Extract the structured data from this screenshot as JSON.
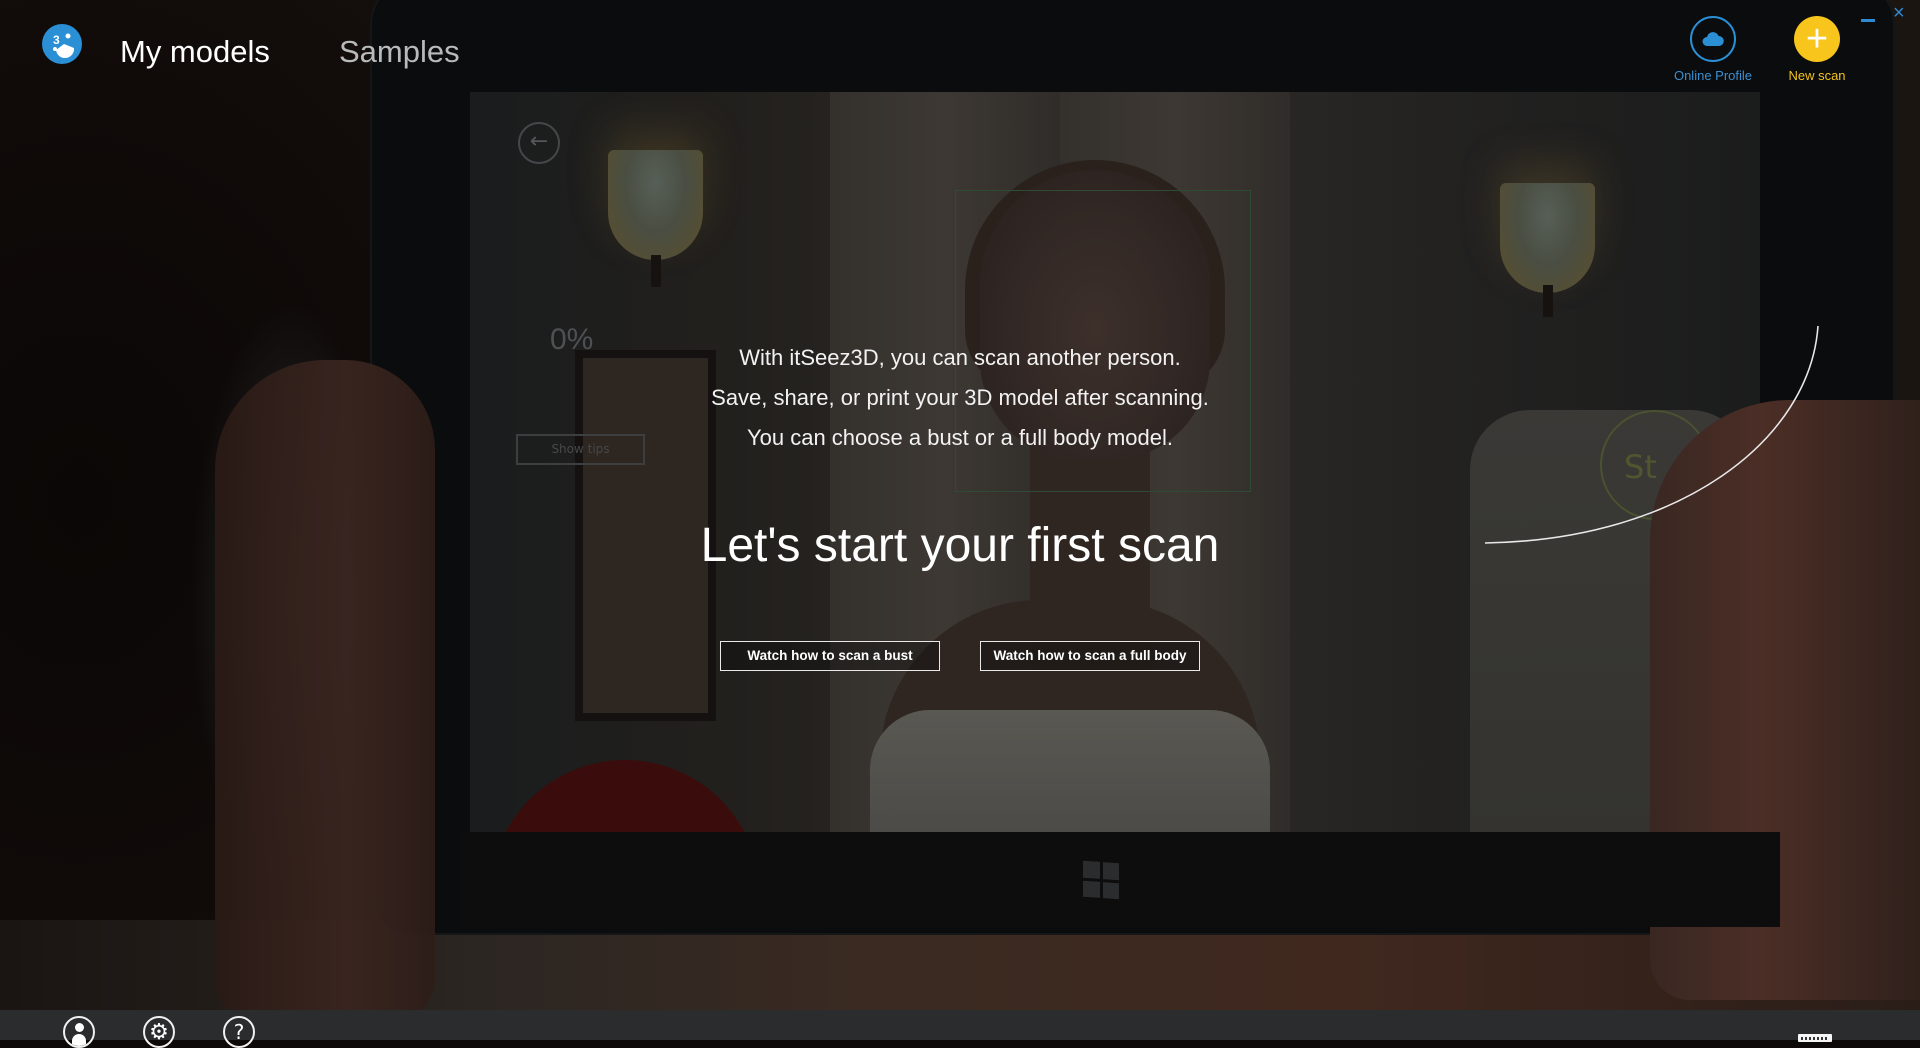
{
  "app": {
    "logo_text": "3D",
    "nav": [
      {
        "label": "My models",
        "active": true
      },
      {
        "label": "Samples",
        "active": false
      }
    ]
  },
  "actions": {
    "online_profile": {
      "label": "Online Profile",
      "icon": "cloud-icon",
      "color": "#2b8fd6"
    },
    "new_scan": {
      "label": "New scan",
      "icon": "plus-icon",
      "symbol": "+",
      "color": "#f7c51c"
    }
  },
  "window_controls": {
    "minimize": "minimize-icon",
    "close": "×"
  },
  "main": {
    "intro_lines": [
      "With itSeez3D, you can scan another person.",
      "Save, share, or print your 3D model after scanning.",
      "You can choose a bust or a full body model."
    ],
    "headline": "Let's start your first scan",
    "buttons": {
      "bust": "Watch how to scan a bust",
      "full_body": "Watch how to scan a full body"
    }
  },
  "background_photo": {
    "description": "Dimmed photo of hands holding a tablet scanning a woman",
    "tablet_ui": {
      "back_symbol": "←",
      "progress": "0%",
      "tips_button": "Show tips",
      "start_label": "St"
    }
  },
  "bottom_bar": {
    "icons": [
      "user-icon",
      "settings-icon",
      "help-icon"
    ],
    "help_symbol": "?",
    "settings_symbol": "⚙"
  }
}
